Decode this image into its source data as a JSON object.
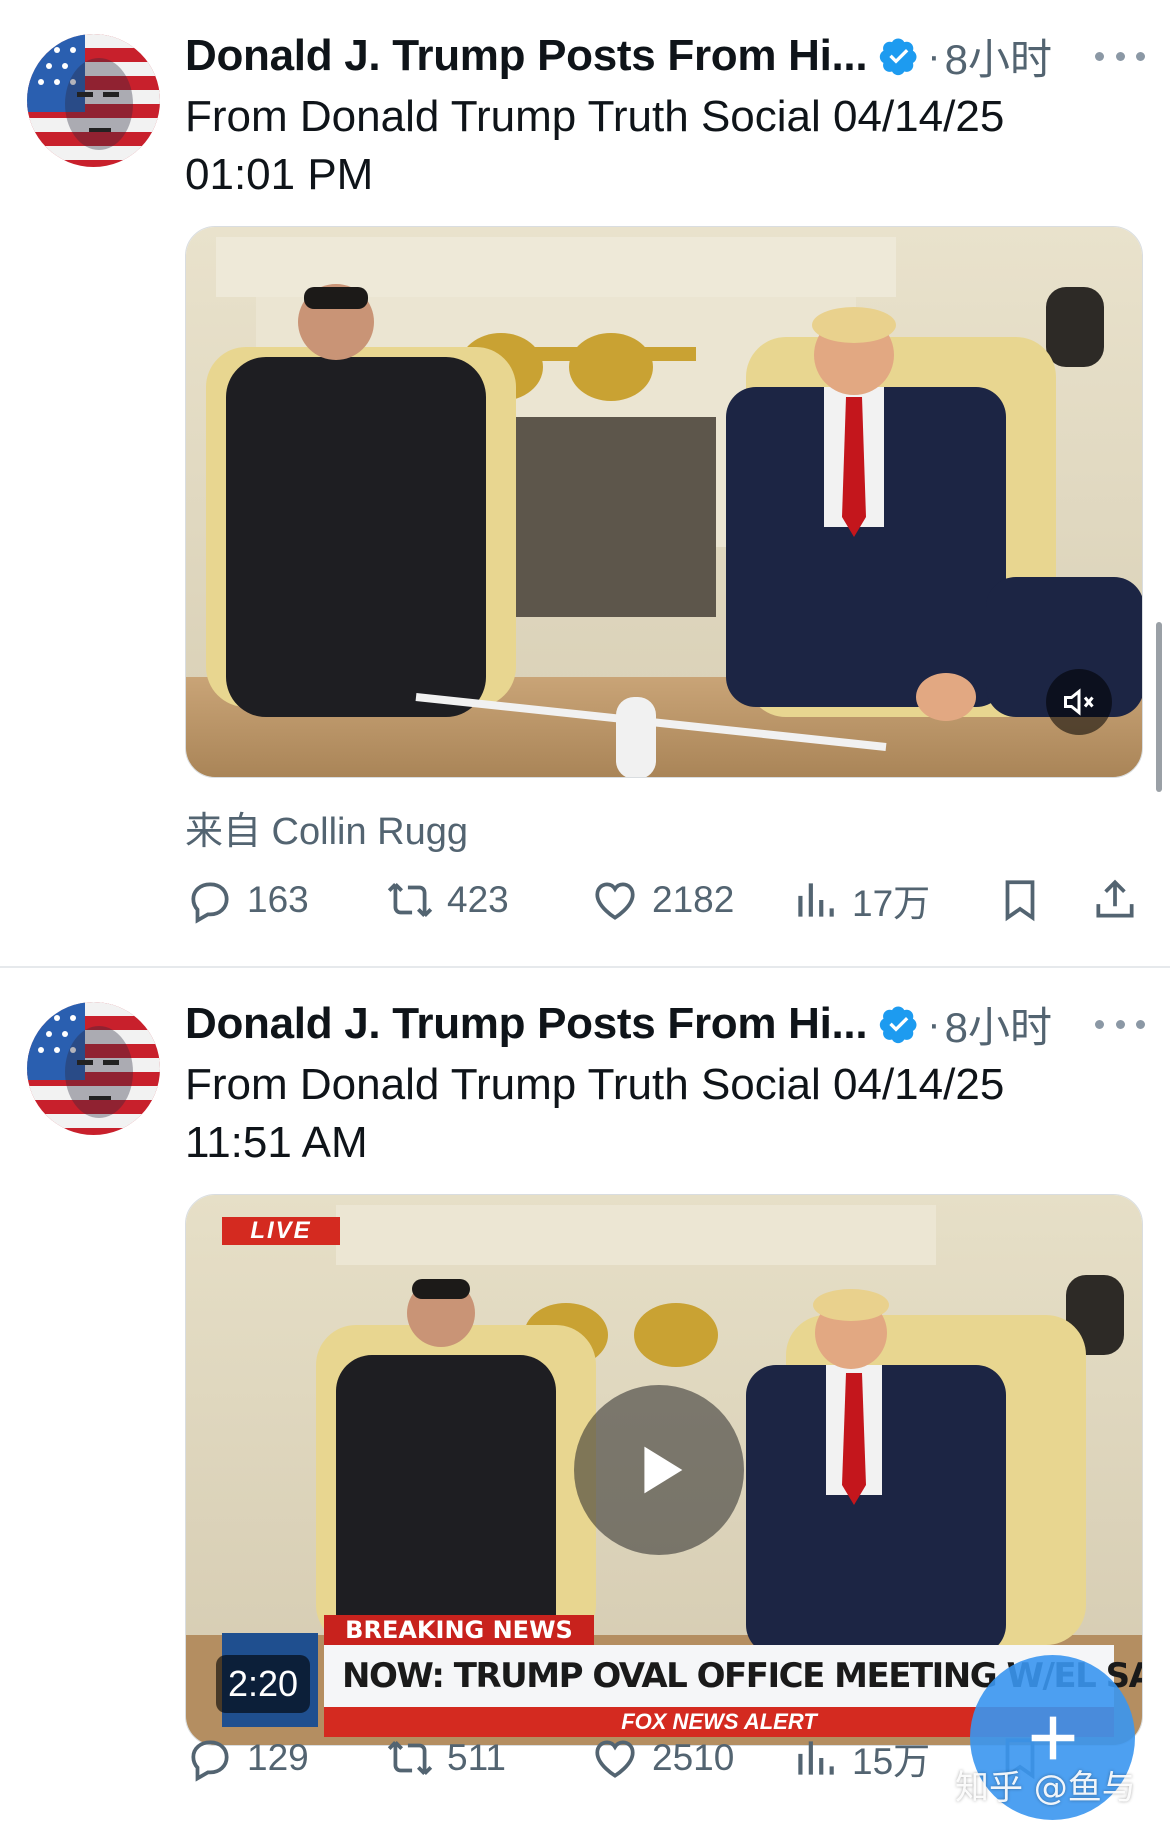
{
  "tweets": [
    {
      "author": "Donald J. Trump Posts From Hi...",
      "separator": "·",
      "time": "8小时",
      "text_line1": "From Donald Trump Truth Social 04/14/25",
      "text_line2": "01:01 PM",
      "source": "来自 Collin Rugg",
      "media_type": "video",
      "counts": {
        "replies": "163",
        "retweets": "423",
        "likes": "2182",
        "views": "17万"
      }
    },
    {
      "author": "Donald J. Trump Posts From Hi...",
      "separator": "·",
      "time": "8小时",
      "text_line1": "From Donald Trump Truth Social 04/14/25",
      "text_line2": "11:51 AM",
      "media_type": "video",
      "duration": "2:20",
      "overlay": {
        "live": "LIVE",
        "breaking": "BREAKING NEWS",
        "headline": "NOW: TRUMP OVAL OFFICE MEETING W/EL SALVADOR PRES",
        "alert": "FOX NEWS ALERT",
        "channel_logo": "FOX"
      },
      "counts": {
        "replies": "129",
        "retweets": "511",
        "likes": "2510",
        "views": "15万"
      }
    }
  ],
  "watermark": "知乎 @鱼与",
  "colors": {
    "text_primary": "#0f1419",
    "text_secondary": "#536471",
    "verified_blue": "#1d9bf0",
    "fab_blue": "#3a96f0"
  },
  "icons": [
    "more-icon",
    "verified-badge-icon",
    "reply-icon",
    "retweet-icon",
    "like-icon",
    "views-icon",
    "bookmark-icon",
    "share-icon",
    "mute-icon",
    "play-icon",
    "compose-plus-icon"
  ]
}
